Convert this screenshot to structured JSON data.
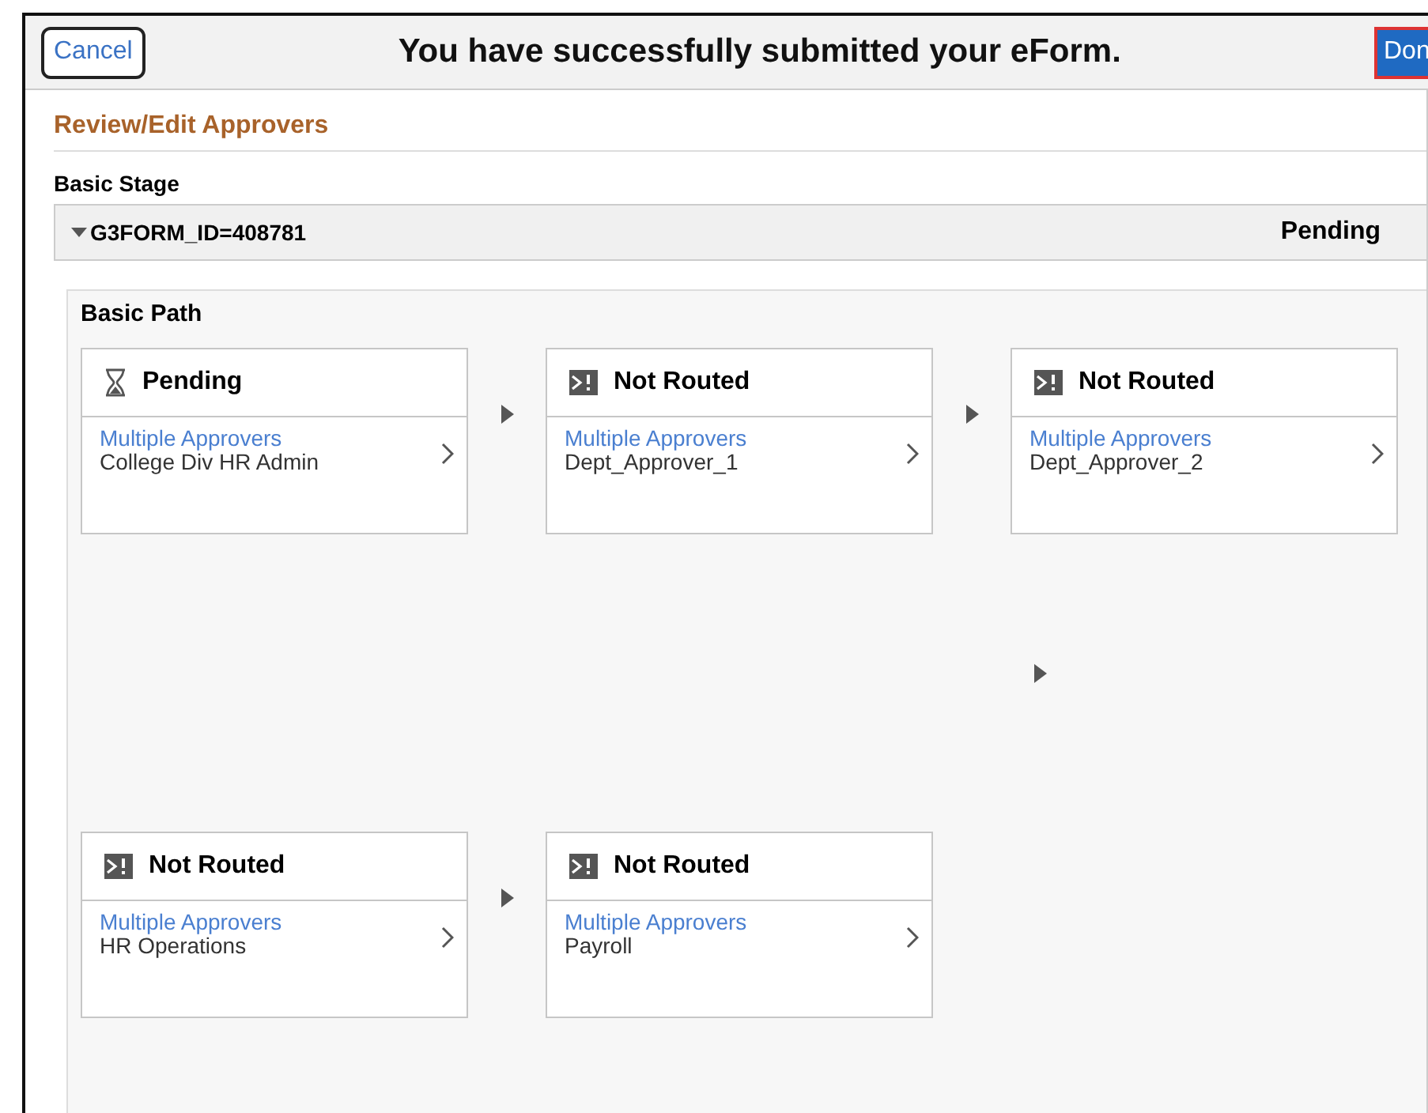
{
  "header": {
    "cancel": "Cancel",
    "title": "You have successfully submitted your eForm.",
    "done": "Don"
  },
  "section_title": "Review/Edit Approvers",
  "stage_title": "Basic Stage",
  "group": {
    "label": "G3FORM_ID=408781",
    "expanded": true,
    "status": "Pending"
  },
  "path_title": "Basic Path",
  "steps": [
    {
      "kind": "pending",
      "status": "Pending",
      "link": "Multiple Approvers",
      "approver": "College Div HR Admin"
    },
    {
      "kind": "not_routed",
      "status": "Not Routed",
      "link": "Multiple Approvers",
      "approver": "Dept_Approver_1"
    },
    {
      "kind": "not_routed",
      "status": "Not Routed",
      "link": "Multiple Approvers",
      "approver": "Dept_Approver_2"
    },
    {
      "kind": "not_routed",
      "status": "Not Routed",
      "link": "Multiple Approvers",
      "approver": "HR Operations"
    },
    {
      "kind": "not_routed",
      "status": "Not Routed",
      "link": "Multiple Approvers",
      "approver": "Payroll"
    }
  ]
}
